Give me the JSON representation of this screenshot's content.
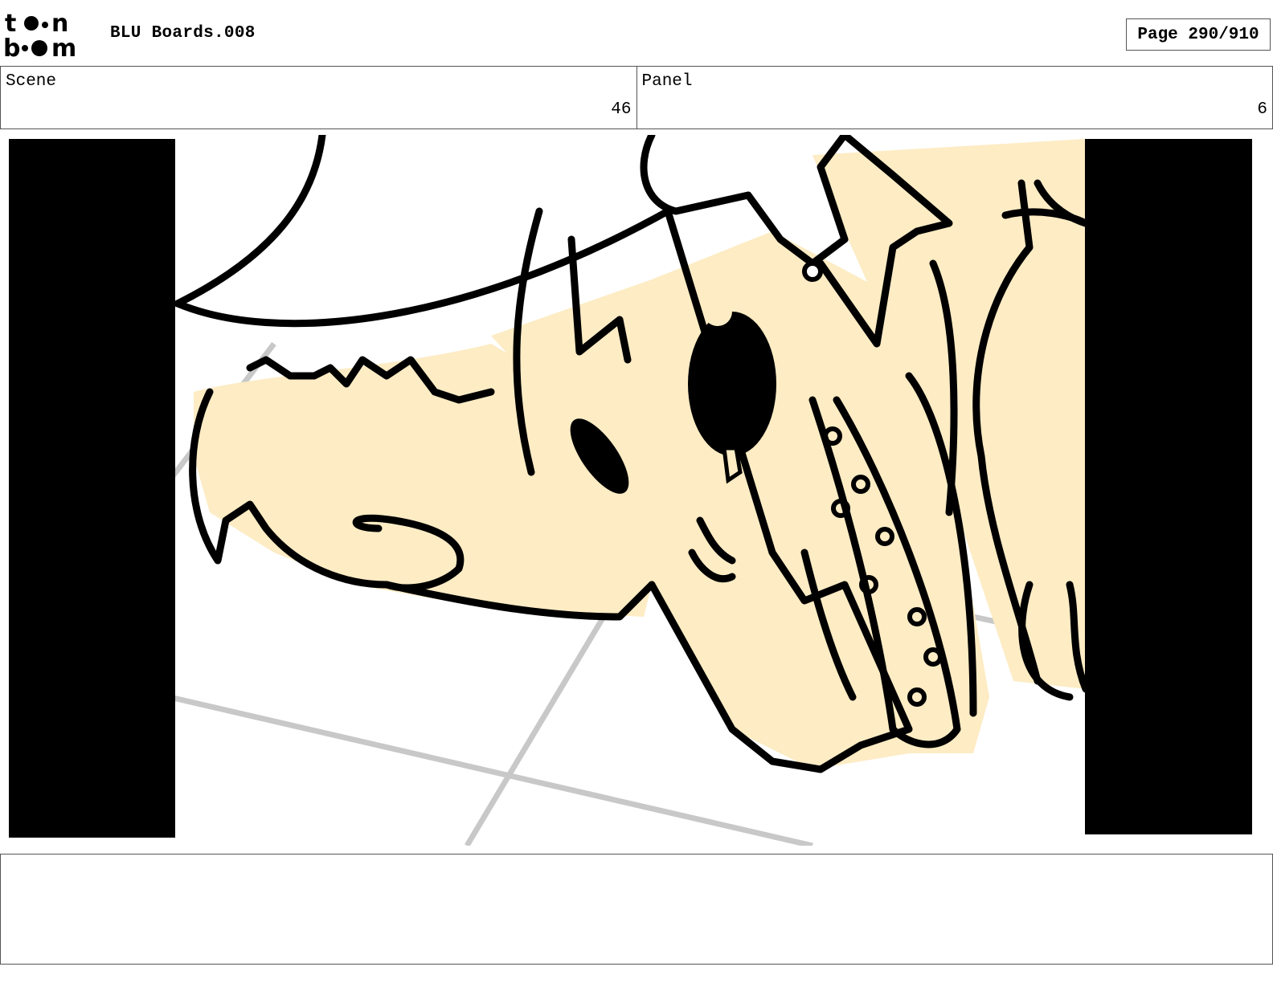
{
  "header": {
    "logo_text": "toon boom",
    "document_title": "BLU Boards.008",
    "page_indicator": "Page 290/910"
  },
  "info": {
    "scene_label": "Scene",
    "scene_value": "46",
    "panel_label": "Panel",
    "panel_value": "6"
  },
  "panel": {
    "colors": {
      "fill": "#fdecc4",
      "ink": "#000000",
      "floor_lines": "#c8c8c8",
      "letterbox": "#000000"
    }
  },
  "notes": {
    "text": ""
  }
}
